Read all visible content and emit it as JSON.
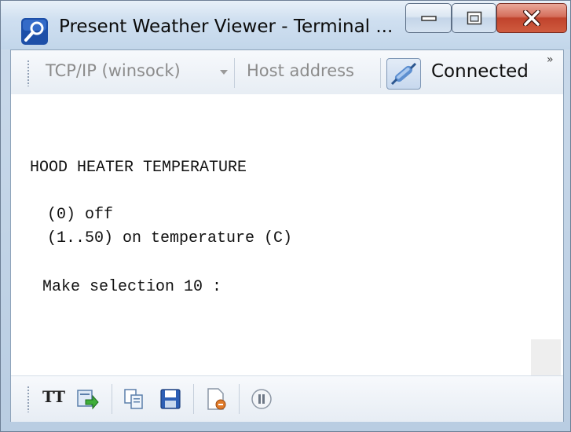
{
  "window": {
    "title": "Present Weather Viewer - Terminal ...",
    "app_icon": "search-magnifier-icon",
    "buttons": {
      "minimize": "minimize-icon",
      "maximize": "maximize-icon",
      "close": "close-icon"
    }
  },
  "toolbar": {
    "connection_type": "TCP/IP (winsock)",
    "host_placeholder": "Host address",
    "status": "Connected",
    "overflow": "»"
  },
  "terminal": {
    "lines": [
      "HOOD HEATER TEMPERATURE",
      " (0) off",
      " (1..50) on temperature (C)",
      " Make selection 10 :"
    ]
  },
  "bottom_toolbar": {
    "font_button": "TT",
    "icons": [
      "font-icon",
      "send-file-icon",
      "copy-icon",
      "save-icon",
      "stop-log-icon",
      "pause-icon"
    ]
  },
  "colors": {
    "close_red": "#c0432c",
    "chrome_blue": "#c2d6ea"
  }
}
